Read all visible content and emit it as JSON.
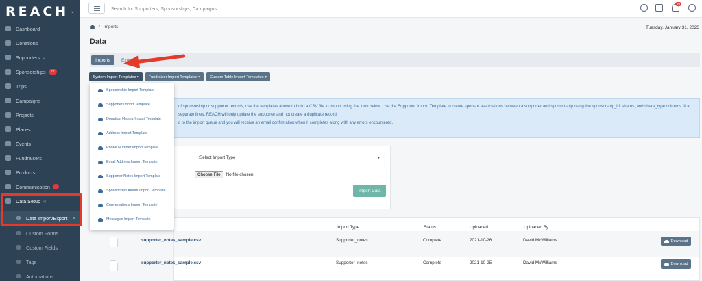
{
  "app": {
    "logo": "REACH"
  },
  "sidebar": {
    "items": [
      {
        "label": "Dashboard"
      },
      {
        "label": "Donations"
      },
      {
        "label": "Supporters"
      },
      {
        "label": "Sponsorships",
        "badge": "27"
      },
      {
        "label": "Trips"
      },
      {
        "label": "Campaigns"
      },
      {
        "label": "Projects"
      },
      {
        "label": "Places"
      },
      {
        "label": "Events"
      },
      {
        "label": "Fundraisers"
      },
      {
        "label": "Products"
      },
      {
        "label": "Communication",
        "badge": "1"
      },
      {
        "label": "Data Setup"
      }
    ],
    "subitems": [
      {
        "label": "Data Import/Export"
      },
      {
        "label": "Custom Forms"
      },
      {
        "label": "Custom Fields"
      },
      {
        "label": "Tags"
      },
      {
        "label": "Automations"
      }
    ]
  },
  "topbar": {
    "search_placeholder": "Search for Supporters, Sponsorships, Campaigns...",
    "notification_count": "99"
  },
  "breadcrumb": {
    "current": "Imports"
  },
  "date": "Tuesday, January 31, 2023",
  "page_title": "Data",
  "tabs": [
    {
      "label": "Imports"
    },
    {
      "label": "Exports"
    }
  ],
  "template_buttons": [
    {
      "label": "System Import Templates ▾"
    },
    {
      "label": "Fundraiser Import Templates ▾"
    },
    {
      "label": "Custom Table Import Templates ▾"
    }
  ],
  "dropdown_items": [
    "Sponsorship Import Template",
    "Supporter Import Template",
    "Donation History Import Template",
    "Address Import Template",
    "Phone Number Import Template",
    "Email Address Import Template",
    "Supporter Notes Import Template",
    "Sponsorship Album Import Template",
    "Conversations Import Template",
    "Messages Import Template"
  ],
  "info": {
    "line1": "of sponsorship or supporter records, use the templates above to build a CSV file to import using the form below. Use the Supporter Import Template to create sponsor associations between a supporter and sponsorship using the sponsorship_id, shares, and share_type columns. If a",
    "line2": "separate lines, REACH will only update the supporter and not create a duplicate record.",
    "line3": "d to the import queue and you will receive an email confirmation when it completes along with any errors encountered."
  },
  "form": {
    "select_placeholder": "Select Import Type",
    "choose_file_label": "Choose File",
    "no_file_label": "No file chosen",
    "import_button": "Import Data"
  },
  "table": {
    "headers": [
      "Import Type",
      "Status",
      "Uploaded",
      "Uploaded By"
    ],
    "rows": [
      {
        "file": "supporter_notes_sample.csv",
        "type": "Supporter_notes",
        "status": "Complete",
        "uploaded": "2021-10-26",
        "by": "David McWilliams",
        "action": "Download"
      },
      {
        "file": "supporter_notes_sample.csv",
        "type": "Supporter_notes",
        "status": "Complete",
        "uploaded": "2021-10-25",
        "by": "David McWilliams",
        "action": "Download"
      }
    ]
  },
  "colors": {
    "sidebar": "#2d4254",
    "accent": "#5b7388",
    "annotation": "#e53a2a",
    "import_button": "#6fb5a8"
  }
}
